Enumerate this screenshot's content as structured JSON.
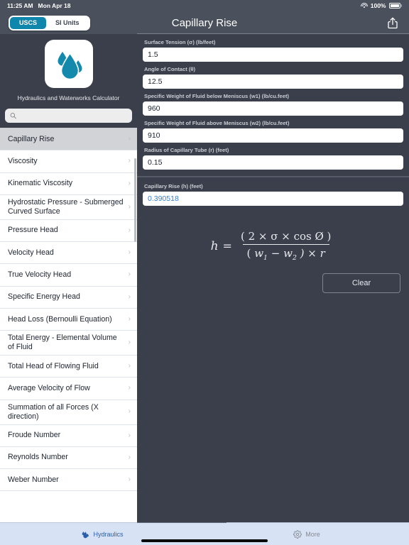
{
  "status_bar": {
    "time": "11:25 AM",
    "date": "Mon Apr 18",
    "battery_percent": "100%",
    "wifi_icon": "wifi-icon",
    "battery_icon": "battery-icon"
  },
  "nav": {
    "title": "Capillary Rise",
    "share_icon": "share-icon",
    "units_segmented": {
      "selected": "USCS",
      "options": [
        "USCS",
        "SI Units"
      ]
    }
  },
  "sidebar": {
    "app_name": "Hydraulics and Waterworks Calculator",
    "app_icon": "water-droplets-icon",
    "search": {
      "icon": "search-icon",
      "value": "",
      "placeholder": ""
    },
    "selected_item": "Capillary Rise",
    "chevron_icon": "chevron-right-icon",
    "items": [
      "Capillary Rise",
      "Viscosity",
      "Kinematic Viscosity",
      "Hydrostatic Pressure - Submerged Curved Surface",
      "Pressure Head",
      "Velocity Head",
      "True Velocity Head",
      "Specific Energy Head",
      "Head Loss (Bernoulli Equation)",
      "Total Energy - Elemental Volume of Fluid",
      "Total Head of Flowing Fluid",
      "Average Velocity of Flow",
      "Summation of all Forces (X direction)",
      "Froude Number",
      "Reynolds Number",
      "Weber Number"
    ]
  },
  "main": {
    "inputs": [
      {
        "label": "Surface Tension (σ) (lb/feet)",
        "value": "1.5"
      },
      {
        "label": "Angle of Contact (θ)",
        "value": "12.5"
      },
      {
        "label": "Specific Weight of Fluid below Meniscus (w1) (lb/cu.feet)",
        "value": "960"
      },
      {
        "label": "Specific Weight of Fluid above Meniscus (w2) (lb/cu.feet)",
        "value": "910"
      },
      {
        "label": "Radius of Capillary Tube (r) (feet)",
        "value": "0.15"
      }
    ],
    "result": {
      "label": "Capillary Rise (h) (feet)",
      "value": "0.390518",
      "color": "#2e7fd6"
    },
    "formula": {
      "lhs": "h",
      "equals": "=",
      "numerator": "( 2 × σ × cos Ø )",
      "denominator_w1": "w",
      "denominator_w1_sub": "1",
      "denominator_minus": "−",
      "denominator_w2": "w",
      "denominator_w2_sub": "2",
      "denominator_open": "(",
      "denominator_close": ") × r"
    },
    "clear_button": "Clear"
  },
  "tabbar": {
    "tabs": [
      {
        "label": "Hydraulics",
        "icon": "water-droplets-icon",
        "active": true
      },
      {
        "label": "More",
        "icon": "gear-icon",
        "active": false
      }
    ]
  },
  "colors": {
    "accent_teal": "#0f86ab",
    "panel_dark": "#3a3f4b",
    "bar_dark": "#4a505c",
    "result_blue": "#2e7fd6",
    "tabbar_blue": "#d7e3f4",
    "tab_active": "#2a5ea8"
  }
}
